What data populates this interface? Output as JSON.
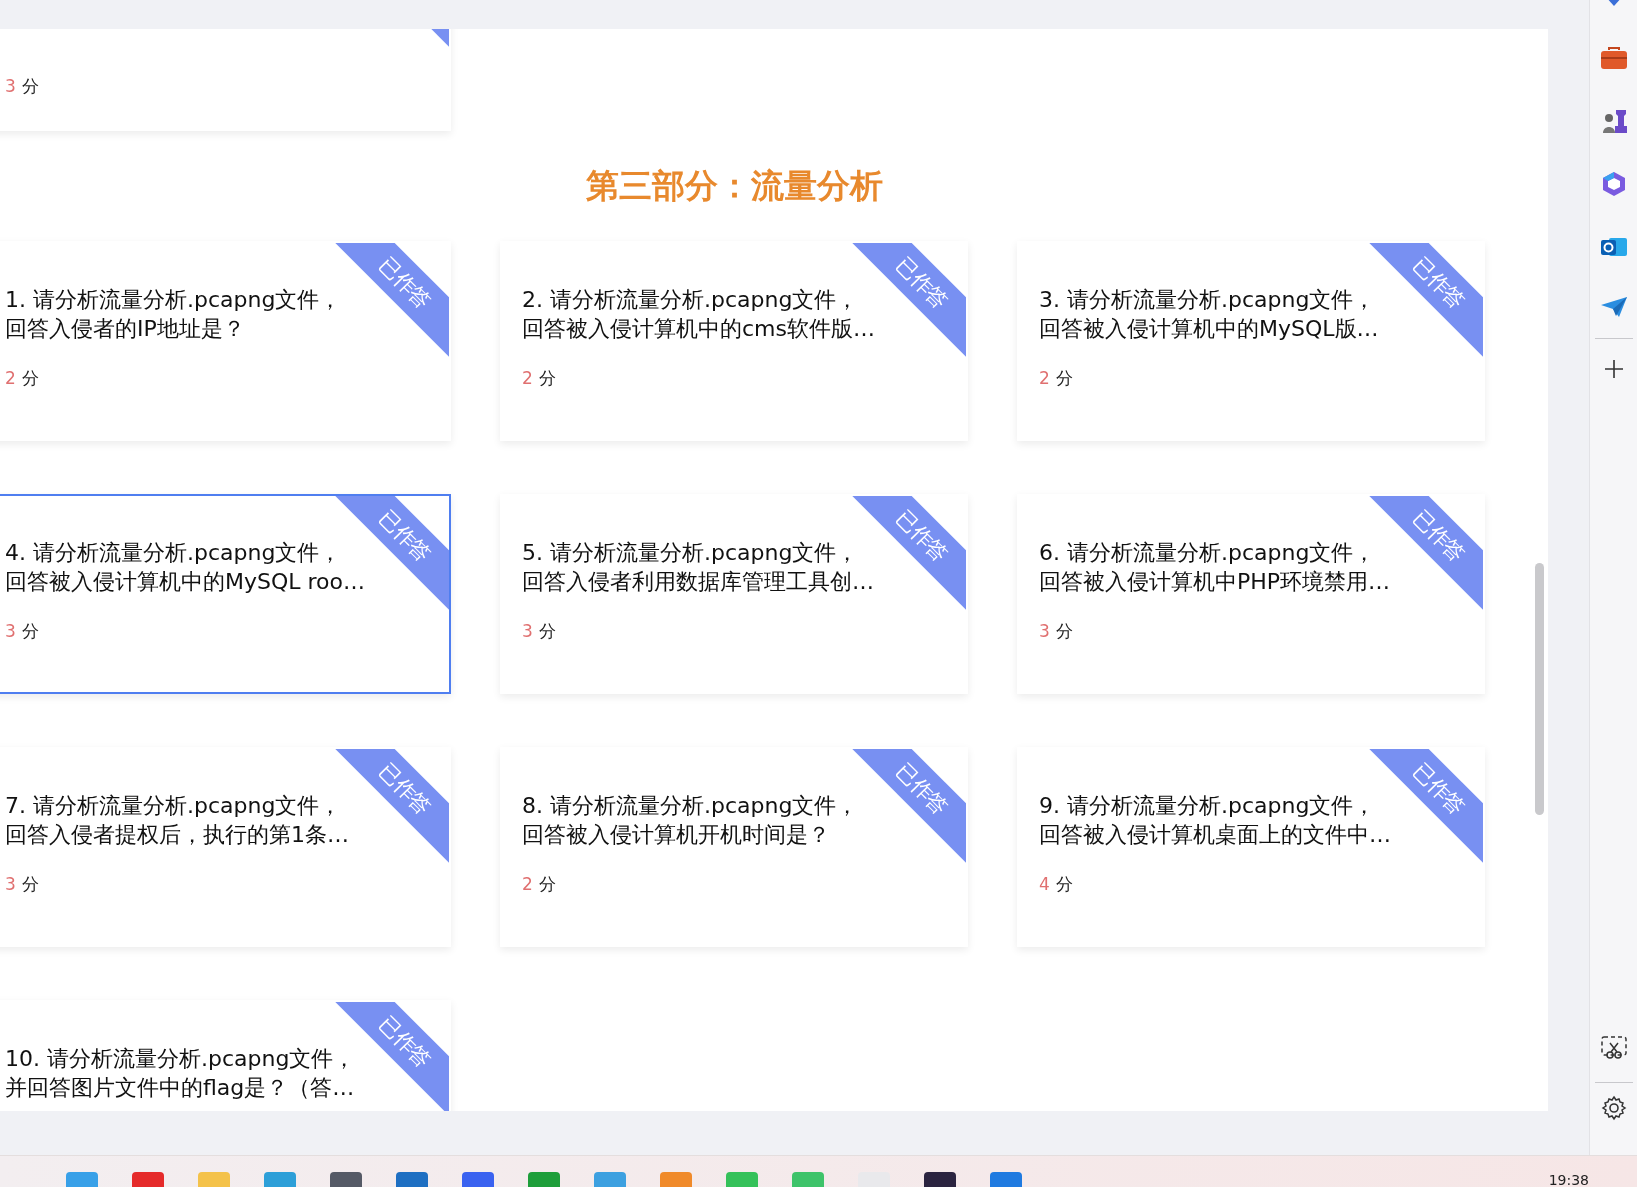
{
  "previous_card": {
    "score": "3",
    "unit": "分",
    "answered": true
  },
  "section_title": "第三部分：流量分析",
  "cards": [
    {
      "title": [
        "1. 请分析流量分析.pcapng文件，",
        "回答入侵者的IP地址是？"
      ],
      "score": "2",
      "unit": "分",
      "status": "已作答",
      "answered": true,
      "selected": false
    },
    {
      "title": [
        "2. 请分析流量分析.pcapng文件，",
        "回答被入侵计算机中的cms软件版…"
      ],
      "score": "2",
      "unit": "分",
      "status": "已作答",
      "answered": true,
      "selected": false
    },
    {
      "title": [
        "3. 请分析流量分析.pcapng文件，",
        "回答被入侵计算机中的MySQL版…"
      ],
      "score": "2",
      "unit": "分",
      "status": "已作答",
      "answered": true,
      "selected": false
    },
    {
      "title": [
        "4. 请分析流量分析.pcapng文件，",
        "回答被入侵计算机中的MySQL roo…"
      ],
      "score": "3",
      "unit": "分",
      "status": "已作答",
      "answered": true,
      "selected": true
    },
    {
      "title": [
        "5. 请分析流量分析.pcapng文件，",
        "回答入侵者利用数据库管理工具创…"
      ],
      "score": "3",
      "unit": "分",
      "status": "已作答",
      "answered": true,
      "selected": false
    },
    {
      "title": [
        "6. 请分析流量分析.pcapng文件，",
        "回答被入侵计算机中PHP环境禁用…"
      ],
      "score": "3",
      "unit": "分",
      "status": "已作答",
      "answered": true,
      "selected": false
    },
    {
      "title": [
        "7. 请分析流量分析.pcapng文件，",
        "回答入侵者提权后，执行的第1条…"
      ],
      "score": "3",
      "unit": "分",
      "status": "已作答",
      "answered": true,
      "selected": false
    },
    {
      "title": [
        "8. 请分析流量分析.pcapng文件，",
        "回答被入侵计算机开机时间是？"
      ],
      "score": "2",
      "unit": "分",
      "status": "已作答",
      "answered": true,
      "selected": false
    },
    {
      "title": [
        "9. 请分析流量分析.pcapng文件，",
        "回答被入侵计算机桌面上的文件中…"
      ],
      "score": "4",
      "unit": "分",
      "status": "已作答",
      "answered": true,
      "selected": false
    },
    {
      "title": [
        "10. 请分析流量分析.pcapng文件，",
        "并回答图片文件中的flag是？（答…"
      ],
      "status": "已作答",
      "answered": true,
      "selected": false
    }
  ],
  "taskbar": {
    "time": "19:38"
  }
}
